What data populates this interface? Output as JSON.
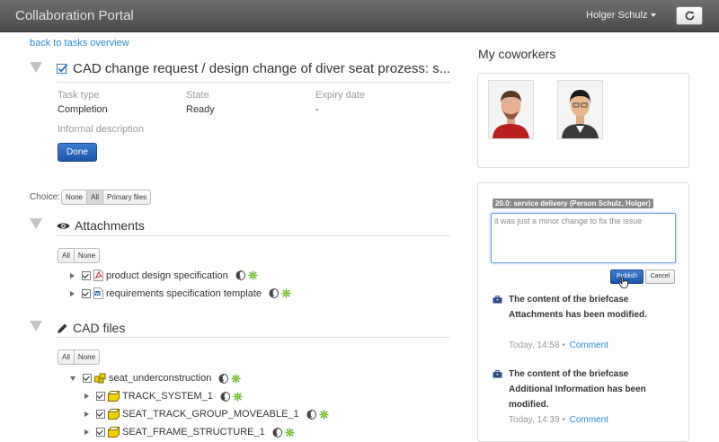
{
  "app": {
    "title": "Collaboration Portal"
  },
  "header": {
    "user_name": "Holger Schulz"
  },
  "nav": {
    "back_link": "back to tasks overview"
  },
  "task": {
    "title": "CAD change request / design change of diver seat prozess: s...",
    "fields": [
      {
        "label": "Task type",
        "value": "Completion"
      },
      {
        "label": "State",
        "value": "Ready"
      },
      {
        "label": "Expiry date",
        "value": "-"
      }
    ],
    "informal_label": "Informal description",
    "done_label": "Done"
  },
  "choice": {
    "label": "Choice:",
    "options": [
      "None",
      "All",
      "Primary files"
    ],
    "selected": "All"
  },
  "attachments": {
    "title": "Attachments",
    "toggle": [
      "All",
      "None"
    ],
    "items": [
      {
        "name": "product design specification",
        "icon": "pdf-icon"
      },
      {
        "name": "requirements specification template",
        "icon": "word-icon"
      }
    ]
  },
  "cad": {
    "title": "CAD files",
    "toggle": [
      "All",
      "None"
    ],
    "root": {
      "name": "seat_underconstruction",
      "icon": "assembly-icon"
    },
    "children": [
      {
        "name": "TRACK_SYSTEM_1",
        "icon": "part-icon"
      },
      {
        "name": "SEAT_TRACK_GROUP_MOVEABLE_1",
        "icon": "part-icon"
      },
      {
        "name": "SEAT_FRAME_STRUCTURE_1",
        "icon": "part-icon"
      }
    ]
  },
  "coworkers": {
    "title": "My coworkers"
  },
  "discussion": {
    "thread_label": "20.0: service delivery (Person Schulz, Holger)",
    "comment_text": "it was just a minor change to fix the issue",
    "publish_label": "Publish",
    "cancel_label": "Cancel",
    "feed": [
      {
        "text": "The content of the briefcase Attachments has been modified.",
        "time": "Today, 14:58",
        "sep": "•",
        "action": "Comment"
      },
      {
        "text": "The content of the briefcase Additional Information has been modified.",
        "time": "Today, 14:39",
        "sep": "•",
        "action": "Comment"
      }
    ]
  },
  "colors": {
    "accent": "#2a8bd4",
    "primary_button": "#1d56a8",
    "topbar": "#5a5a5a"
  }
}
